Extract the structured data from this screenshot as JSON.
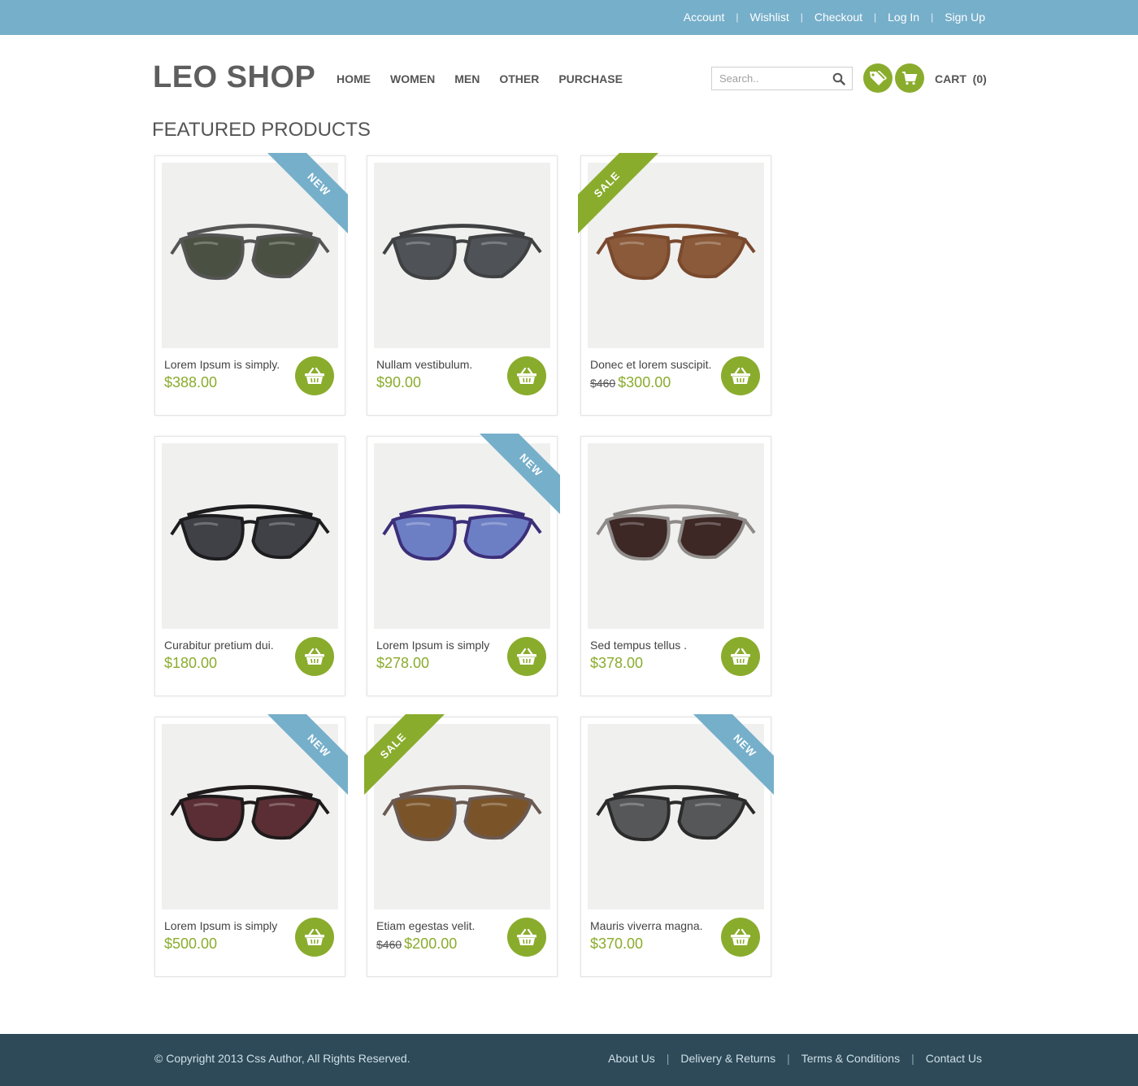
{
  "topbar": {
    "links": [
      "Account",
      "Wishlist",
      "Checkout",
      "Log In",
      "Sign Up"
    ],
    "separator": "|"
  },
  "header": {
    "logo": "LEO SHOP",
    "nav": [
      "HOME",
      "WOMEN",
      "MEN",
      "OTHER",
      "PURCHASE"
    ],
    "search_placeholder": "Search..",
    "cart_label": "CART",
    "cart_count": "(0)"
  },
  "section_title": "FEATURED PRODUCTS",
  "products": [
    {
      "name": "Lorem Ipsum is simply.",
      "old_price": "",
      "price": "$388.00",
      "badge": "NEW",
      "badge_side": "right",
      "frame": "#555555",
      "lens": "#4a5142"
    },
    {
      "name": "Nullam vestibulum.",
      "old_price": "",
      "price": "$90.00",
      "badge": "",
      "badge_side": "",
      "frame": "#3f4143",
      "lens": "#4f5256"
    },
    {
      "name": "Donec et lorem suscipit.",
      "old_price": "$460",
      "price": "$300.00",
      "badge": "SALE",
      "badge_side": "left",
      "frame": "#7a4a2e",
      "lens": "#8a5a3a"
    },
    {
      "name": "Curabitur pretium dui.",
      "old_price": "",
      "price": "$180.00",
      "badge": "",
      "badge_side": "",
      "frame": "#1d1d1f",
      "lens": "#3f4147"
    },
    {
      "name": "Lorem Ipsum is simply",
      "old_price": "",
      "price": "$278.00",
      "badge": "NEW",
      "badge_side": "right",
      "frame": "#3b2f7a",
      "lens": "#6d7fc4"
    },
    {
      "name": "Sed tempus tellus .",
      "old_price": "",
      "price": "$378.00",
      "badge": "",
      "badge_side": "",
      "frame": "#8e8a88",
      "lens": "#3d2826"
    },
    {
      "name": "Lorem Ipsum is simply",
      "old_price": "",
      "price": "$500.00",
      "badge": "NEW",
      "badge_side": "right",
      "frame": "#1f1a1c",
      "lens": "#5a2e34"
    },
    {
      "name": "Etiam egestas velit.",
      "old_price": "$460",
      "price": "$200.00",
      "badge": "SALE",
      "badge_side": "left",
      "frame": "#6a5a52",
      "lens": "#7a5428"
    },
    {
      "name": "Mauris viverra magna.",
      "old_price": "",
      "price": "$370.00",
      "badge": "NEW",
      "badge_side": "right",
      "frame": "#2b2b2b",
      "lens": "#555759"
    }
  ],
  "footer": {
    "copyright": "© Copyright 2013 Css Author, All Rights Reserved.",
    "links": [
      "About Us",
      "Delivery & Returns",
      "Terms & Conditions",
      "Contact Us"
    ],
    "separator": "|"
  },
  "colors": {
    "topbar": "#76afca",
    "accent_green": "#8aac2d",
    "footer": "#2e4a58"
  }
}
